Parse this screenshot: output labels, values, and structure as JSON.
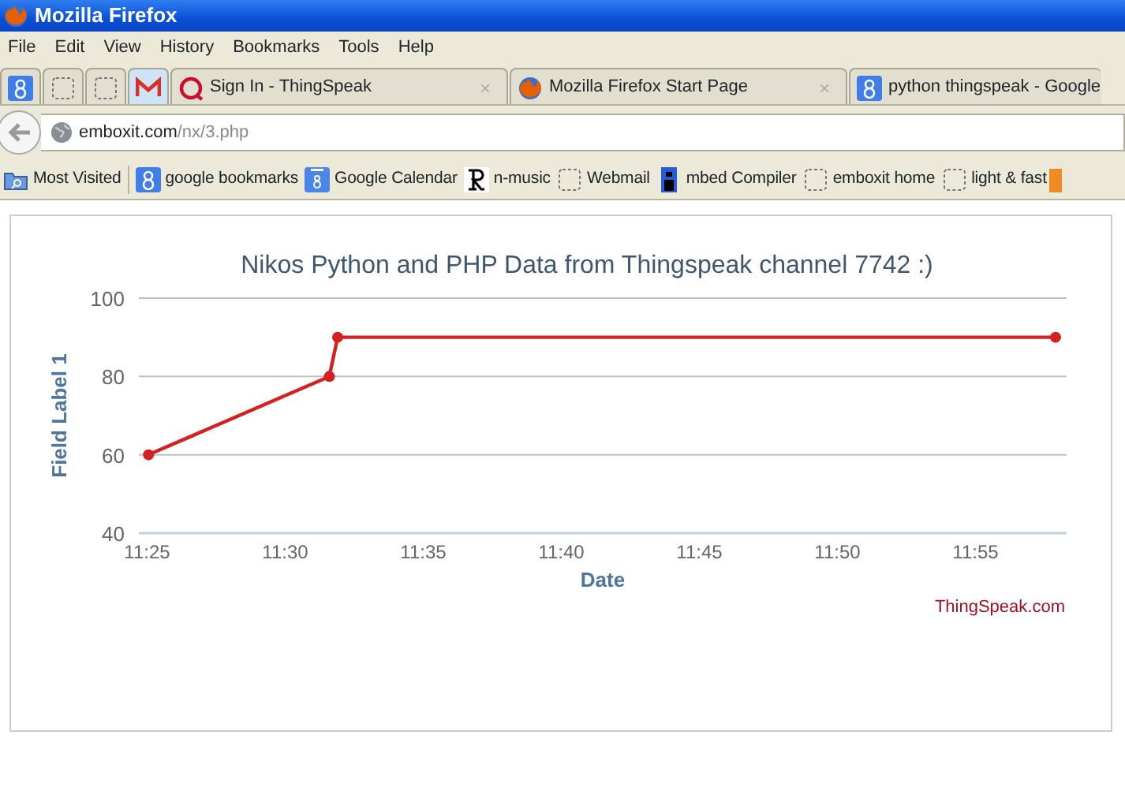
{
  "window": {
    "title": "Mozilla Firefox"
  },
  "menu": [
    "File",
    "Edit",
    "View",
    "History",
    "Bookmarks",
    "Tools",
    "Help"
  ],
  "tabs": [
    {
      "kind": "google",
      "selected": false
    },
    {
      "kind": "blank",
      "selected": false
    },
    {
      "kind": "blank",
      "selected": false
    },
    {
      "kind": "gmail",
      "selected": true
    },
    {
      "kind": "thingspeak",
      "title": "Sign In - ThingSpeak",
      "close": "×",
      "selected": false
    },
    {
      "kind": "firefox",
      "title": "Mozilla Firefox Start Page",
      "close": "×",
      "selected": false
    },
    {
      "kind": "google",
      "title": "python thingspeak - Google",
      "selected": false
    }
  ],
  "address": {
    "host": "emboxit.com",
    "path": "/nx/3.php"
  },
  "bookmarks": [
    {
      "kind": "folder",
      "label": "Most Visited"
    },
    {
      "kind": "google",
      "label": "google bookmarks"
    },
    {
      "kind": "calendar",
      "label": "Google Calendar"
    },
    {
      "kind": "r",
      "label": "n-music"
    },
    {
      "kind": "blank",
      "label": "Webmail"
    },
    {
      "kind": "mbed",
      "label": "mbed Compiler"
    },
    {
      "kind": "blank",
      "label": "emboxit home"
    },
    {
      "kind": "blank",
      "label": "light & fast"
    },
    {
      "kind": "orange"
    }
  ],
  "chart": {
    "credit": "ThingSpeak.com",
    "chart_data": {
      "type": "line",
      "title": "Nikos Python and PHP Data from Thingspeak channel 7742 :)",
      "xlabel": "Date",
      "ylabel": "Field Label 1",
      "x": [
        685.05,
        691.6,
        691.9,
        717.9
      ],
      "series": [
        {
          "color": "#d62020",
          "marker": "circle",
          "values": [
            60,
            80,
            90,
            90
          ]
        }
      ],
      "xlim": [
        684.7,
        718.3
      ],
      "ylim": [
        40,
        100
      ],
      "xticks": [
        {
          "value": 685,
          "label": "11:25"
        },
        {
          "value": 690,
          "label": "11:30"
        },
        {
          "value": 695,
          "label": "11:35"
        },
        {
          "value": 700,
          "label": "11:40"
        },
        {
          "value": 705,
          "label": "11:45"
        },
        {
          "value": 710,
          "label": "11:50"
        },
        {
          "value": 715,
          "label": "11:55"
        }
      ],
      "yticks": [
        40,
        60,
        80,
        100
      ]
    }
  }
}
